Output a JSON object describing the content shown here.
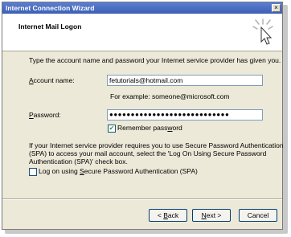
{
  "window": {
    "title": "Internet Connection Wizard",
    "close_label": "×"
  },
  "header": {
    "title": "Internet Mail Logon"
  },
  "instructions": "Type the account name and password your Internet service provider has given you.",
  "account": {
    "label_prefix": "",
    "label_accel": "A",
    "label_rest": "ccount name:",
    "value": "fetutorials@hotmail.com",
    "example": "For example: someone@microsoft.com"
  },
  "password": {
    "label_accel": "P",
    "label_rest": "assword:",
    "value": "●●●●●●●●●●●●●●●●●●●●●●●●●●●●"
  },
  "remember": {
    "checked": true,
    "check_glyph": "✔",
    "label_prefix": "Remember pass",
    "label_accel": "w",
    "label_rest": "ord"
  },
  "spa": {
    "note_line1": "If your Internet service provider requires you to use Secure Password Authentication",
    "note_line2": "(SPA) to access your mail account, select the 'Log On Using Secure Password",
    "note_line3": "Authentication (SPA)' check box.",
    "checked": false,
    "label_prefix": "Log on using ",
    "label_accel": "S",
    "label_rest": "ecure Password Authentication (SPA)"
  },
  "buttons": {
    "back_prefix": "< ",
    "back_accel": "B",
    "back_rest": "ack",
    "next_accel": "N",
    "next_rest": "ext >",
    "cancel": "Cancel"
  }
}
